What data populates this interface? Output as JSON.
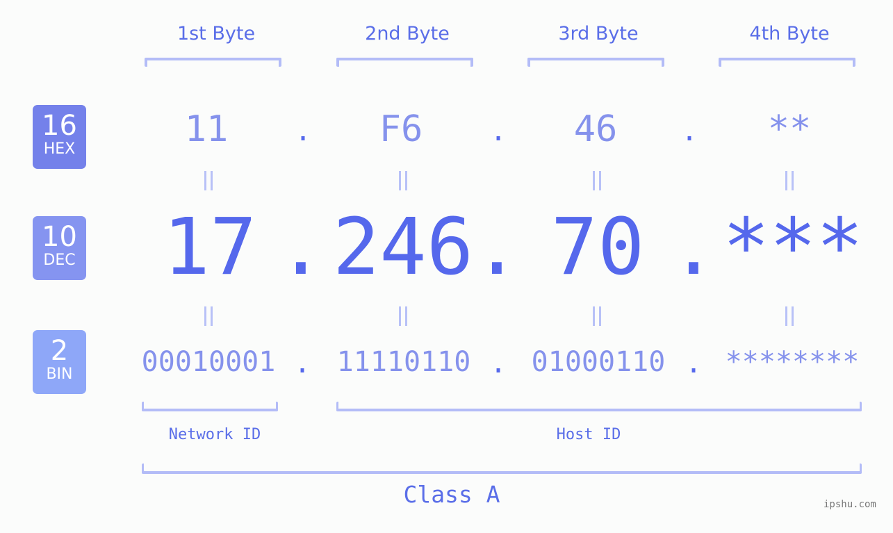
{
  "bytes": {
    "headers": [
      "1st Byte",
      "2nd Byte",
      "3rd Byte",
      "4th Byte"
    ]
  },
  "badges": {
    "hex": {
      "base": "16",
      "label": "HEX",
      "color": "#7481ea"
    },
    "dec": {
      "base": "10",
      "label": "DEC",
      "color": "#8594f0"
    },
    "bin": {
      "base": "2",
      "label": "BIN",
      "color": "#8ea7f8"
    }
  },
  "hex": [
    "11",
    "F6",
    "46",
    "**"
  ],
  "dec": [
    "17",
    "246",
    "70",
    "***"
  ],
  "bin": [
    "00010001",
    "11110110",
    "01000110",
    "********"
  ],
  "separator": ".",
  "equals_symbol": "||",
  "segments": {
    "network_label": "Network ID",
    "host_label": "Host ID",
    "class_label": "Class A"
  },
  "watermark": "ipshu.com",
  "colors": {
    "accent": "#5568ec",
    "light_accent": "#8592ec",
    "bracket": "#b3bcf7"
  }
}
